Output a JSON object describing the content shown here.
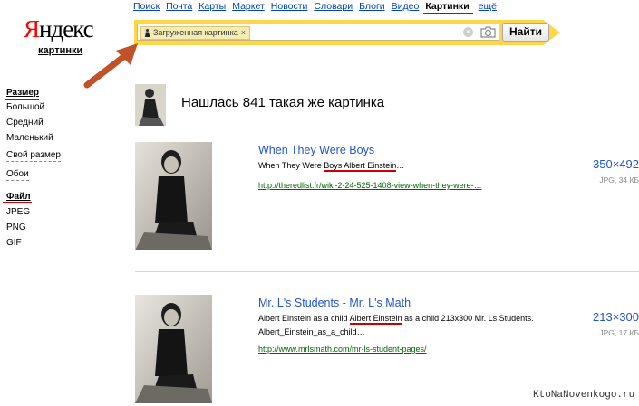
{
  "nav": {
    "items": [
      "Поиск",
      "Почта",
      "Карты",
      "Маркет",
      "Новости",
      "Словари",
      "Блоги",
      "Видео"
    ],
    "active": "Картинки",
    "more": "ещё"
  },
  "logo": {
    "first_letter": "Я",
    "rest": "ндекс",
    "subtitle": "картинки"
  },
  "search": {
    "chip_label": "Загруженная картинка",
    "chip_close": "×",
    "clear": "×",
    "submit_label": "Найти"
  },
  "sidebar": {
    "size_heading": "Размер",
    "size_options": [
      "Большой",
      "Средний",
      "Маленький"
    ],
    "custom_size": "Свой размер",
    "wallpapers": "Обои",
    "file_heading": "Файл",
    "file_options": [
      "JPEG",
      "PNG",
      "GIF"
    ]
  },
  "found_text": "Нашлась 841 такая же картинка",
  "results": [
    {
      "title": "When They Were Boys",
      "desc_before": "When They Were ",
      "desc_highlight": "Boys Albert Einstein",
      "desc_after": "…",
      "url": "http://theredlist.fr/wiki-2-24-525-1408-view-when-they-were-…",
      "size": "350×492",
      "meta": "JPG, 34 КБ"
    },
    {
      "title": "Mr. L's Students - Mr. L's Math",
      "desc_before": "Albert Einstein as a child ",
      "desc_highlight": "Albert Einstein",
      "desc_after": " as a child 213x300 Mr. Ls Students. Albert_Einstein_as_a_child…",
      "url": "http://www.mrlsmath.com/mr-ls-student-pages/",
      "size": "213×300",
      "meta": "JPG, 17 КБ"
    }
  ],
  "watermark": "KtoNaNovenkogo.ru",
  "colors": {
    "search_yellow": "#ffd64a",
    "link_blue": "#2255cc",
    "url_green": "#006600",
    "highlight_red": "#cc0000"
  },
  "icons": {
    "camera": "camera-icon",
    "clear": "close-icon",
    "arrow": "arrow-annotation"
  }
}
